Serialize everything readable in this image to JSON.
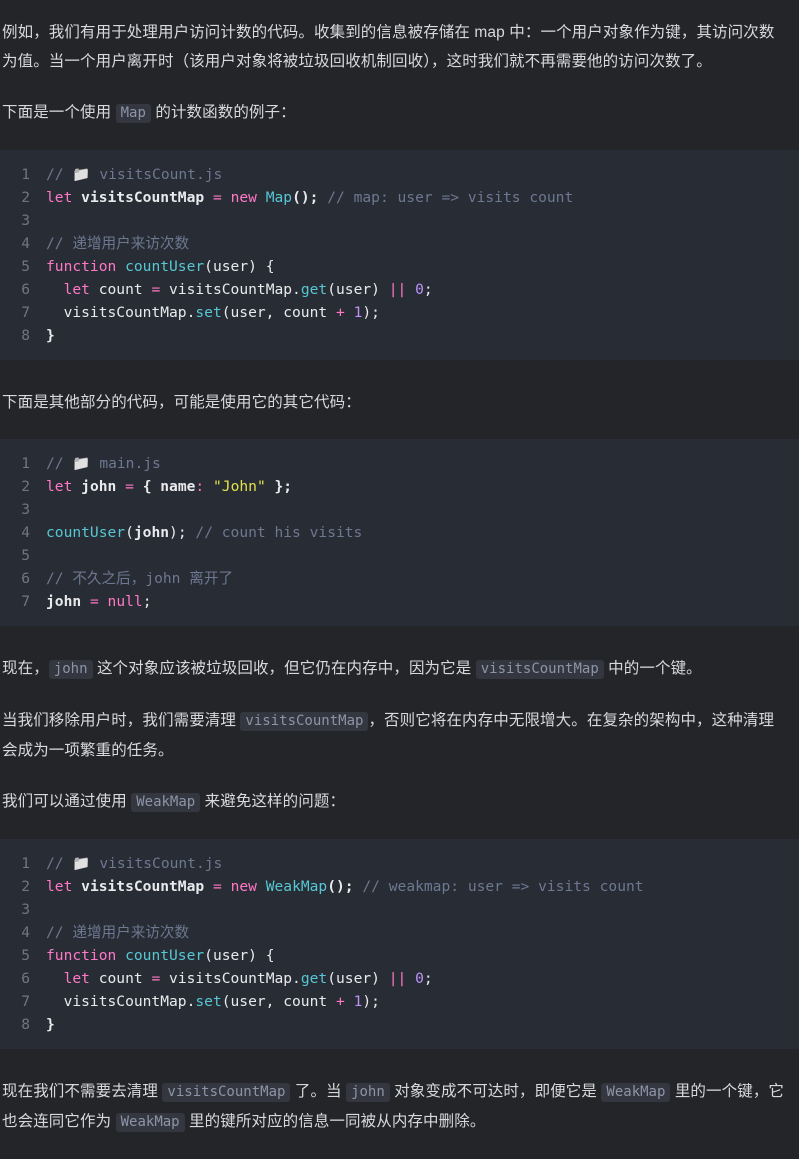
{
  "theme": {
    "page_bg": "#242528",
    "code_bg": "#282c34",
    "text": "#d8d9dc",
    "inline_code_bg": "#34373f",
    "inline_code_text": "#8d94a8",
    "line_number": "#6f7682",
    "token_comment": "#6d7891",
    "token_keyword": "#ff79c6",
    "token_function": "#57c7d4",
    "token_number": "#bd93f9",
    "token_string": "#e3e34b",
    "token_plain": "#e9eaee"
  },
  "paragraphs": {
    "intro_p1_a": "例如，我们有用于处理用户访问计数的代码。收集到的信息被存储在 map 中：一个用户对象作为键，其访问次数为值。当一个用户离开时（该用户对象将被垃圾回收机制回收），这时我们就不再需要他的访问次数了。",
    "p_example_pre": "下面是一个使用 ",
    "p_example_code": "Map",
    "p_example_post": " 的计数函数的例子：",
    "p_other_code": "下面是其他部分的代码，可能是使用它的其它代码：",
    "p_now_a": "现在，",
    "p_now_code1": "john",
    "p_now_b": " 这个对象应该被垃圾回收，但它仍在内存中，因为它是 ",
    "p_now_code2": "visitsCountMap",
    "p_now_c": " 中的一个键。",
    "p_remove_a": "当我们移除用户时，我们需要清理 ",
    "p_remove_code": "visitsCountMap",
    "p_remove_b": "，否则它将在内存中无限增大。在复杂的架构中，这种清理会成为一项繁重的任务。",
    "p_avoid_a": "我们可以通过使用 ",
    "p_avoid_code": "WeakMap",
    "p_avoid_b": " 来避免这样的问题：",
    "p_final_a": "现在我们不需要去清理 ",
    "p_final_code1": "visitsCountMap",
    "p_final_b": " 了。当 ",
    "p_final_code2": "john",
    "p_final_c": " 对象变成不可达时，即便它是 ",
    "p_final_code3": "WeakMap",
    "p_final_d": " 里的一个键，它也会连同它作为 ",
    "p_final_code4": "WeakMap",
    "p_final_e": " 里的键所对应的信息一同被从内存中删除。"
  },
  "code_blocks": [
    {
      "id": "visitscount-map",
      "language": "javascript",
      "filename": "visitsCount.js",
      "line_numbers": [
        "1",
        "2",
        "3",
        "4",
        "5",
        "6",
        "7",
        "8"
      ],
      "lines": [
        [
          {
            "t": "// ",
            "c": "t-com"
          },
          {
            "t": "📁",
            "c": "t-emoji"
          },
          {
            "t": " visitsCount.js",
            "c": "t-com"
          }
        ],
        [
          {
            "t": "let",
            "c": "t-key"
          },
          {
            "t": " ",
            "c": "t-punc"
          },
          {
            "t": "visitsCountMap",
            "c": "t-pl"
          },
          {
            "t": " ",
            "c": "t-punc"
          },
          {
            "t": "=",
            "c": "t-op"
          },
          {
            "t": " ",
            "c": "t-punc"
          },
          {
            "t": "new",
            "c": "t-key"
          },
          {
            "t": " ",
            "c": "t-punc"
          },
          {
            "t": "Map",
            "c": "t-cls"
          },
          {
            "t": "();",
            "c": "t-pl"
          },
          {
            "t": " ",
            "c": "t-punc"
          },
          {
            "t": "// map: user => visits count",
            "c": "t-com"
          }
        ],
        [],
        [
          {
            "t": "// 递增用户来访次数",
            "c": "t-com"
          }
        ],
        [
          {
            "t": "function",
            "c": "t-key"
          },
          {
            "t": " ",
            "c": "t-punc"
          },
          {
            "t": "countUser",
            "c": "t-fn"
          },
          {
            "t": "(",
            "c": "t-punc"
          },
          {
            "t": "user",
            "c": "t-var"
          },
          {
            "t": ") {",
            "c": "t-punc"
          }
        ],
        [
          {
            "t": "  ",
            "c": "t-punc"
          },
          {
            "t": "let",
            "c": "t-key"
          },
          {
            "t": " ",
            "c": "t-punc"
          },
          {
            "t": "count",
            "c": "t-var"
          },
          {
            "t": " ",
            "c": "t-punc"
          },
          {
            "t": "=",
            "c": "t-op"
          },
          {
            "t": " visitsCountMap.",
            "c": "t-var"
          },
          {
            "t": "get",
            "c": "t-fn"
          },
          {
            "t": "(user) ",
            "c": "t-var"
          },
          {
            "t": "||",
            "c": "t-op"
          },
          {
            "t": " ",
            "c": "t-punc"
          },
          {
            "t": "0",
            "c": "t-num"
          },
          {
            "t": ";",
            "c": "t-punc"
          }
        ],
        [
          {
            "t": "  visitsCountMap.",
            "c": "t-var"
          },
          {
            "t": "set",
            "c": "t-fn"
          },
          {
            "t": "(user, count ",
            "c": "t-var"
          },
          {
            "t": "+",
            "c": "t-op"
          },
          {
            "t": " ",
            "c": "t-punc"
          },
          {
            "t": "1",
            "c": "t-num"
          },
          {
            "t": ");",
            "c": "t-punc"
          }
        ],
        [
          {
            "t": "}",
            "c": "t-pl"
          }
        ]
      ]
    },
    {
      "id": "main-js",
      "language": "javascript",
      "filename": "main.js",
      "line_numbers": [
        "1",
        "2",
        "3",
        "4",
        "5",
        "6",
        "7"
      ],
      "lines": [
        [
          {
            "t": "// ",
            "c": "t-com"
          },
          {
            "t": "📁",
            "c": "t-emoji"
          },
          {
            "t": " main.js",
            "c": "t-com"
          }
        ],
        [
          {
            "t": "let",
            "c": "t-key"
          },
          {
            "t": " ",
            "c": "t-punc"
          },
          {
            "t": "john",
            "c": "t-pl"
          },
          {
            "t": " ",
            "c": "t-punc"
          },
          {
            "t": "=",
            "c": "t-op"
          },
          {
            "t": " { ",
            "c": "t-pl"
          },
          {
            "t": "name",
            "c": "t-pl"
          },
          {
            "t": ":",
            "c": "t-op"
          },
          {
            "t": " ",
            "c": "t-punc"
          },
          {
            "t": "\"John\"",
            "c": "t-str"
          },
          {
            "t": " };",
            "c": "t-pl"
          }
        ],
        [],
        [
          {
            "t": "countUser",
            "c": "t-fn"
          },
          {
            "t": "(",
            "c": "t-punc"
          },
          {
            "t": "john",
            "c": "t-pl"
          },
          {
            "t": ");",
            "c": "t-punc"
          },
          {
            "t": " ",
            "c": "t-punc"
          },
          {
            "t": "// count his visits",
            "c": "t-com"
          }
        ],
        [],
        [
          {
            "t": "// 不久之后，john 离开了",
            "c": "t-com"
          }
        ],
        [
          {
            "t": "john",
            "c": "t-pl"
          },
          {
            "t": " ",
            "c": "t-punc"
          },
          {
            "t": "=",
            "c": "t-op"
          },
          {
            "t": " ",
            "c": "t-punc"
          },
          {
            "t": "null",
            "c": "t-key"
          },
          {
            "t": ";",
            "c": "t-punc"
          }
        ]
      ]
    },
    {
      "id": "visitscount-weakmap",
      "language": "javascript",
      "filename": "visitsCount.js",
      "line_numbers": [
        "1",
        "2",
        "3",
        "4",
        "5",
        "6",
        "7",
        "8"
      ],
      "lines": [
        [
          {
            "t": "// ",
            "c": "t-com"
          },
          {
            "t": "📁",
            "c": "t-emoji"
          },
          {
            "t": " visitsCount.js",
            "c": "t-com"
          }
        ],
        [
          {
            "t": "let",
            "c": "t-key"
          },
          {
            "t": " ",
            "c": "t-punc"
          },
          {
            "t": "visitsCountMap",
            "c": "t-pl"
          },
          {
            "t": " ",
            "c": "t-punc"
          },
          {
            "t": "=",
            "c": "t-op"
          },
          {
            "t": " ",
            "c": "t-punc"
          },
          {
            "t": "new",
            "c": "t-key"
          },
          {
            "t": " ",
            "c": "t-punc"
          },
          {
            "t": "WeakMap",
            "c": "t-cls"
          },
          {
            "t": "();",
            "c": "t-pl"
          },
          {
            "t": " ",
            "c": "t-punc"
          },
          {
            "t": "// weakmap: user => visits count",
            "c": "t-com"
          }
        ],
        [],
        [
          {
            "t": "// 递增用户来访次数",
            "c": "t-com"
          }
        ],
        [
          {
            "t": "function",
            "c": "t-key"
          },
          {
            "t": " ",
            "c": "t-punc"
          },
          {
            "t": "countUser",
            "c": "t-fn"
          },
          {
            "t": "(",
            "c": "t-punc"
          },
          {
            "t": "user",
            "c": "t-var"
          },
          {
            "t": ") {",
            "c": "t-punc"
          }
        ],
        [
          {
            "t": "  ",
            "c": "t-punc"
          },
          {
            "t": "let",
            "c": "t-key"
          },
          {
            "t": " ",
            "c": "t-punc"
          },
          {
            "t": "count",
            "c": "t-var"
          },
          {
            "t": " ",
            "c": "t-punc"
          },
          {
            "t": "=",
            "c": "t-op"
          },
          {
            "t": " visitsCountMap.",
            "c": "t-var"
          },
          {
            "t": "get",
            "c": "t-fn"
          },
          {
            "t": "(user) ",
            "c": "t-var"
          },
          {
            "t": "||",
            "c": "t-op"
          },
          {
            "t": " ",
            "c": "t-punc"
          },
          {
            "t": "0",
            "c": "t-num"
          },
          {
            "t": ";",
            "c": "t-punc"
          }
        ],
        [
          {
            "t": "  visitsCountMap.",
            "c": "t-var"
          },
          {
            "t": "set",
            "c": "t-fn"
          },
          {
            "t": "(user, count ",
            "c": "t-var"
          },
          {
            "t": "+",
            "c": "t-op"
          },
          {
            "t": " ",
            "c": "t-punc"
          },
          {
            "t": "1",
            "c": "t-num"
          },
          {
            "t": ");",
            "c": "t-punc"
          }
        ],
        [
          {
            "t": "}",
            "c": "t-pl"
          }
        ]
      ]
    }
  ]
}
